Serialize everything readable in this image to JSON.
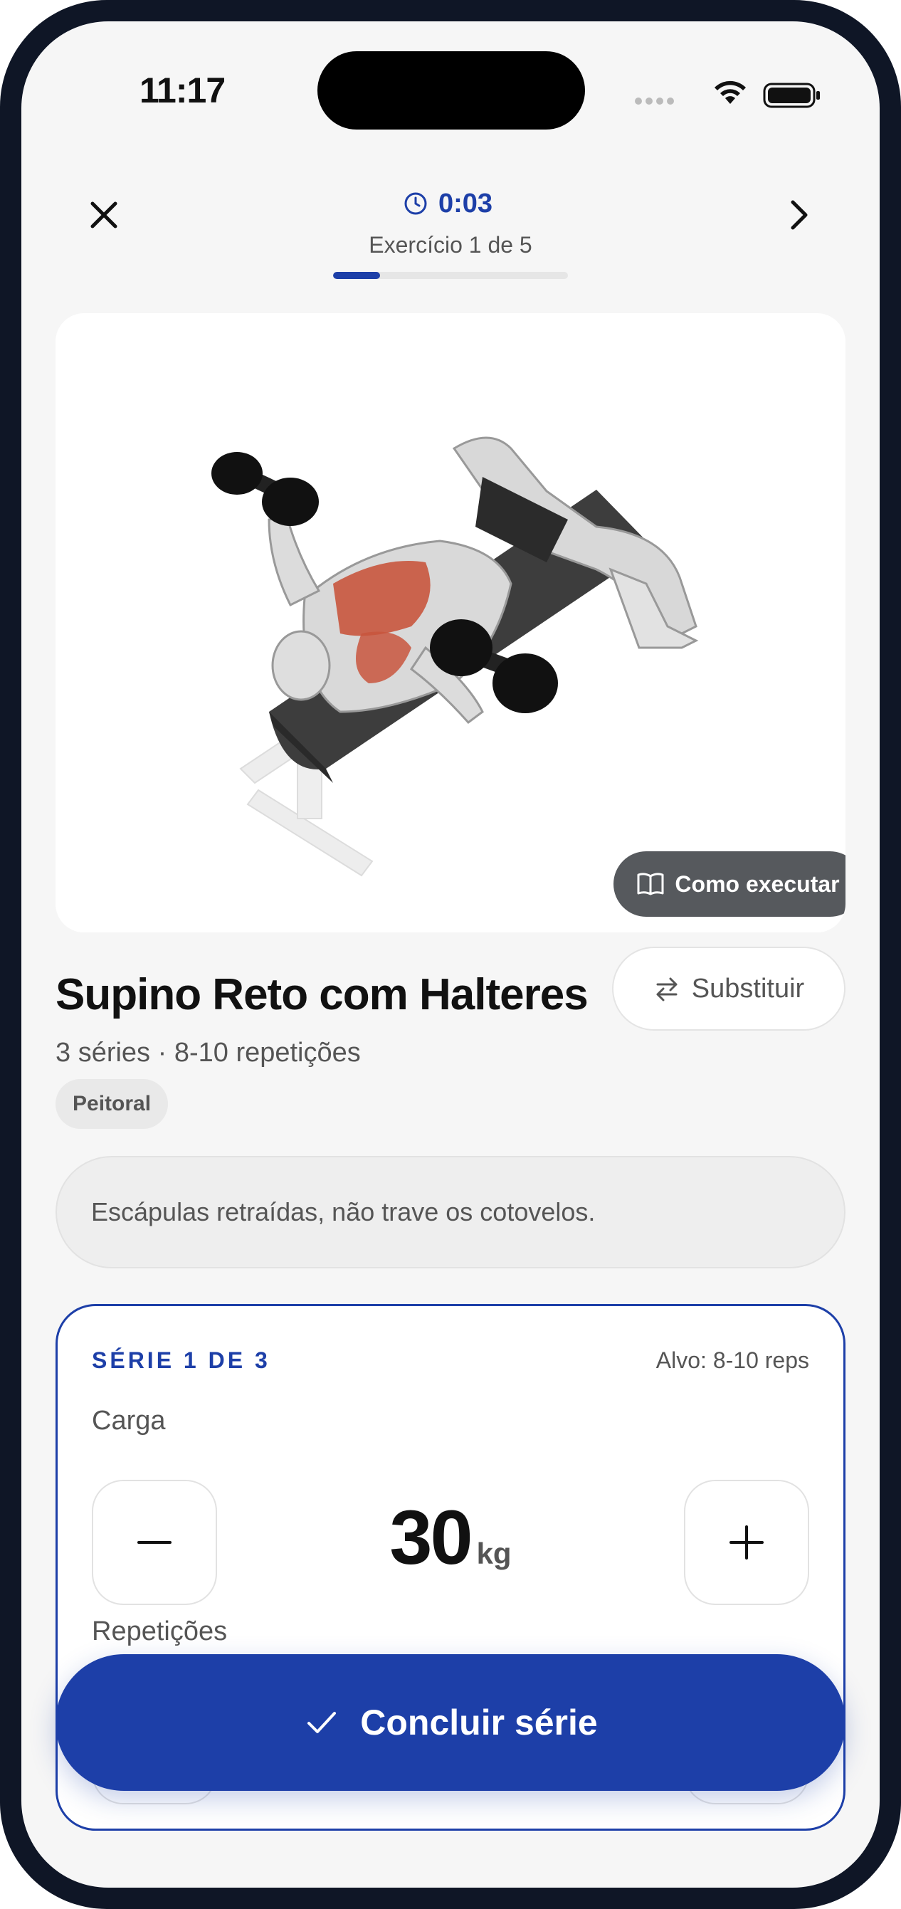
{
  "status_bar": {
    "time": "11:17"
  },
  "header": {
    "timer": "0:03",
    "exercise_counter": "Exercício 1 de 5",
    "progress_fraction": 0.2
  },
  "media": {
    "how_to_label": "Como executar"
  },
  "exercise": {
    "name": "Supino Reto com Halteres",
    "summary": "3 séries · 8-10 repetições",
    "swap_label": "Substituir",
    "muscle": "Peitoral",
    "tip": "Escápulas retraídas, não trave os cotovelos."
  },
  "set": {
    "label": "SÉRIE 1 DE 3",
    "target": "Alvo: 8-10 reps",
    "load_label": "Carga",
    "load_value": "30",
    "load_unit": "kg",
    "reps_label": "Repetições"
  },
  "actions": {
    "complete_label": "Concluir série"
  },
  "colors": {
    "accent": "#1d3fa8",
    "muscle_highlight": "#c8553d"
  }
}
